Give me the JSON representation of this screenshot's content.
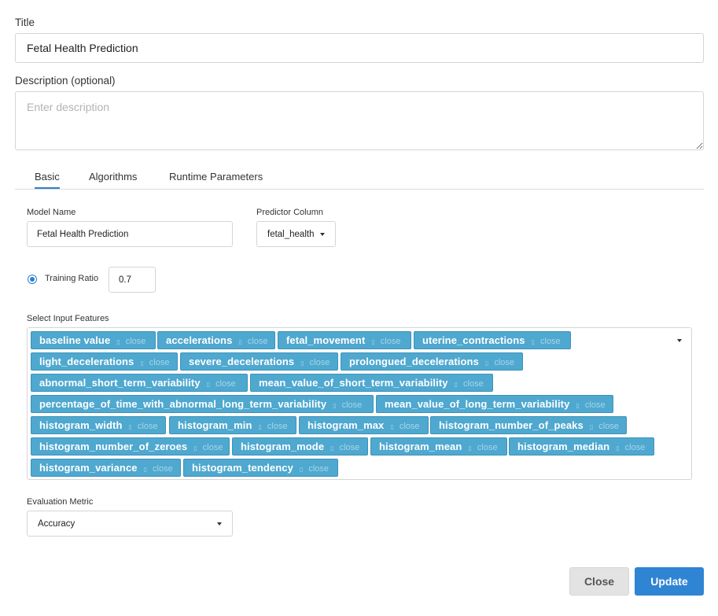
{
  "form": {
    "title_label": "Title",
    "title_value": "Fetal Health Prediction",
    "description_label": "Description (optional)",
    "description_placeholder": "Enter description",
    "description_value": ""
  },
  "tabs": [
    {
      "label": "Basic",
      "active": true
    },
    {
      "label": "Algorithms",
      "active": false
    },
    {
      "label": "Runtime Parameters",
      "active": false
    }
  ],
  "basic": {
    "model_name_label": "Model Name",
    "model_name_value": "Fetal Health Prediction",
    "predictor_label": "Predictor Column",
    "predictor_value": "fetal_health",
    "training_ratio_label": "Training Ratio",
    "training_ratio_value": "0.7",
    "training_ratio_selected": true,
    "features_label": "Select Input Features",
    "close_text": "close",
    "features": [
      "baseline value",
      "accelerations",
      "fetal_movement",
      "uterine_contractions",
      "light_decelerations",
      "severe_decelerations",
      "prolongued_decelerations",
      "abnormal_short_term_variability",
      "mean_value_of_short_term_variability",
      "percentage_of_time_with_abnormal_long_term_variability",
      "mean_value_of_long_term_variability",
      "histogram_width",
      "histogram_min",
      "histogram_max",
      "histogram_number_of_peaks",
      "histogram_number_of_zeroes",
      "histogram_mode",
      "histogram_mean",
      "histogram_median",
      "histogram_variance",
      "histogram_tendency"
    ],
    "metric_label": "Evaluation Metric",
    "metric_value": "Accuracy"
  },
  "actions": {
    "close_label": "Close",
    "update_label": "Update"
  },
  "colors": {
    "accent": "#2f84d3",
    "tag_background": "#4fa8cf"
  },
  "icons": {
    "dropdown": "caret-down-icon",
    "tag_remove": "close-icon"
  }
}
